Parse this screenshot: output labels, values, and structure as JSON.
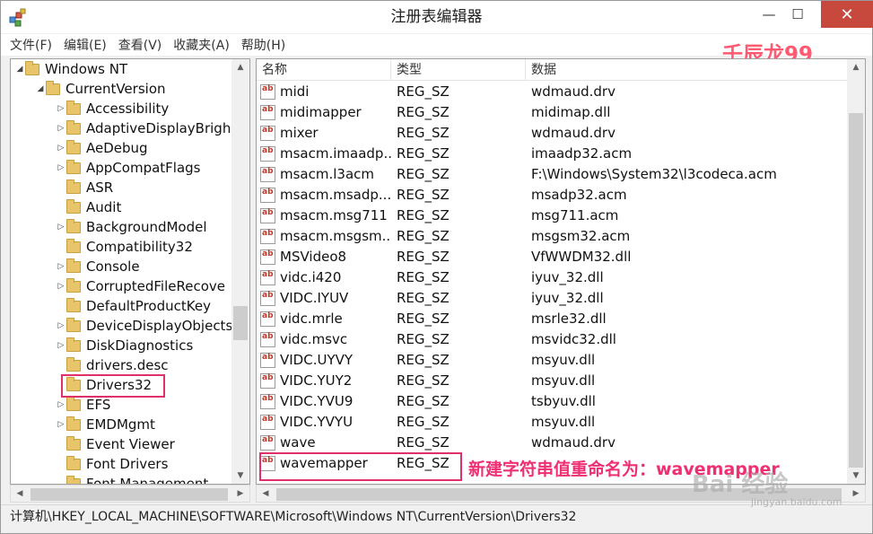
{
  "window": {
    "title": "注册表编辑器"
  },
  "controls": {
    "minimize": "—",
    "maximize": "☐",
    "close": "✕"
  },
  "menu": [
    "文件(F)",
    "编辑(E)",
    "查看(V)",
    "收藏夹(A)",
    "帮助(H)"
  ],
  "tree": {
    "items": [
      {
        "label": "Windows NT",
        "level": 0,
        "arrow": "◢"
      },
      {
        "label": "CurrentVersion",
        "level": 1,
        "arrow": "◢"
      },
      {
        "label": "Accessibility",
        "level": 2,
        "arrow": "▷"
      },
      {
        "label": "AdaptiveDisplayBrigh",
        "level": 2,
        "arrow": "▷"
      },
      {
        "label": "AeDebug",
        "level": 2,
        "arrow": "▷"
      },
      {
        "label": "AppCompatFlags",
        "level": 2,
        "arrow": "▷"
      },
      {
        "label": "ASR",
        "level": 2,
        "arrow": ""
      },
      {
        "label": "Audit",
        "level": 2,
        "arrow": ""
      },
      {
        "label": "BackgroundModel",
        "level": 2,
        "arrow": "▷"
      },
      {
        "label": "Compatibility32",
        "level": 2,
        "arrow": ""
      },
      {
        "label": "Console",
        "level": 2,
        "arrow": "▷"
      },
      {
        "label": "CorruptedFileRecove",
        "level": 2,
        "arrow": "▷"
      },
      {
        "label": "DefaultProductKey",
        "level": 2,
        "arrow": ""
      },
      {
        "label": "DeviceDisplayObjects",
        "level": 2,
        "arrow": "▷"
      },
      {
        "label": "DiskDiagnostics",
        "level": 2,
        "arrow": "▷"
      },
      {
        "label": "drivers.desc",
        "level": 2,
        "arrow": ""
      },
      {
        "label": "Drivers32",
        "level": 2,
        "arrow": ""
      },
      {
        "label": "EFS",
        "level": 2,
        "arrow": "▷"
      },
      {
        "label": "EMDMgmt",
        "level": 2,
        "arrow": "▷"
      },
      {
        "label": "Event Viewer",
        "level": 2,
        "arrow": ""
      },
      {
        "label": "Font Drivers",
        "level": 2,
        "arrow": ""
      },
      {
        "label": "Font Management",
        "level": 2,
        "arrow": ""
      }
    ],
    "scroll_up": "▲",
    "scroll_down": "▼"
  },
  "list": {
    "columns": [
      "名称",
      "类型",
      "数据"
    ],
    "icon_text": "ab",
    "rows": [
      {
        "name": "midi",
        "type": "REG_SZ",
        "data": "wdmaud.drv"
      },
      {
        "name": "midimapper",
        "type": "REG_SZ",
        "data": "midimap.dll"
      },
      {
        "name": "mixer",
        "type": "REG_SZ",
        "data": "wdmaud.drv"
      },
      {
        "name": "msacm.imaadp...",
        "type": "REG_SZ",
        "data": "imaadp32.acm"
      },
      {
        "name": "msacm.l3acm",
        "type": "REG_SZ",
        "data": "F:\\Windows\\System32\\l3codeca.acm"
      },
      {
        "name": "msacm.msadp...",
        "type": "REG_SZ",
        "data": "msadp32.acm"
      },
      {
        "name": "msacm.msg711",
        "type": "REG_SZ",
        "data": "msg711.acm"
      },
      {
        "name": "msacm.msgsm...",
        "type": "REG_SZ",
        "data": "msgsm32.acm"
      },
      {
        "name": "MSVideo8",
        "type": "REG_SZ",
        "data": "VfWWDM32.dll"
      },
      {
        "name": "vidc.i420",
        "type": "REG_SZ",
        "data": "iyuv_32.dll"
      },
      {
        "name": "VIDC.IYUV",
        "type": "REG_SZ",
        "data": "iyuv_32.dll"
      },
      {
        "name": "vidc.mrle",
        "type": "REG_SZ",
        "data": "msrle32.dll"
      },
      {
        "name": "vidc.msvc",
        "type": "REG_SZ",
        "data": "msvidc32.dll"
      },
      {
        "name": "VIDC.UYVY",
        "type": "REG_SZ",
        "data": "msyuv.dll"
      },
      {
        "name": "VIDC.YUY2",
        "type": "REG_SZ",
        "data": "msyuv.dll"
      },
      {
        "name": "VIDC.YVU9",
        "type": "REG_SZ",
        "data": "tsbyuv.dll"
      },
      {
        "name": "VIDC.YVYU",
        "type": "REG_SZ",
        "data": "msyuv.dll"
      },
      {
        "name": "wave",
        "type": "REG_SZ",
        "data": "wdmaud.drv"
      },
      {
        "name": "wavemapper",
        "type": "REG_SZ",
        "data": ""
      }
    ],
    "scroll_up": "▲",
    "scroll_down": "▼"
  },
  "hscroll": {
    "left": "◀",
    "right": "▶"
  },
  "annotation": "新建字符串值重命名为：wavemapper",
  "status": "计算机\\HKEY_LOCAL_MACHINE\\SOFTWARE\\Microsoft\\Windows NT\\CurrentVersion\\Drivers32",
  "watermarks": {
    "author": "壬辰龙99",
    "site_logo": "Bai 经验",
    "site_url": "jingyan.baidu.com"
  },
  "colors": {
    "highlight": "#e0306a",
    "close_button": "#c7493d",
    "folder": "#e8c46a"
  }
}
